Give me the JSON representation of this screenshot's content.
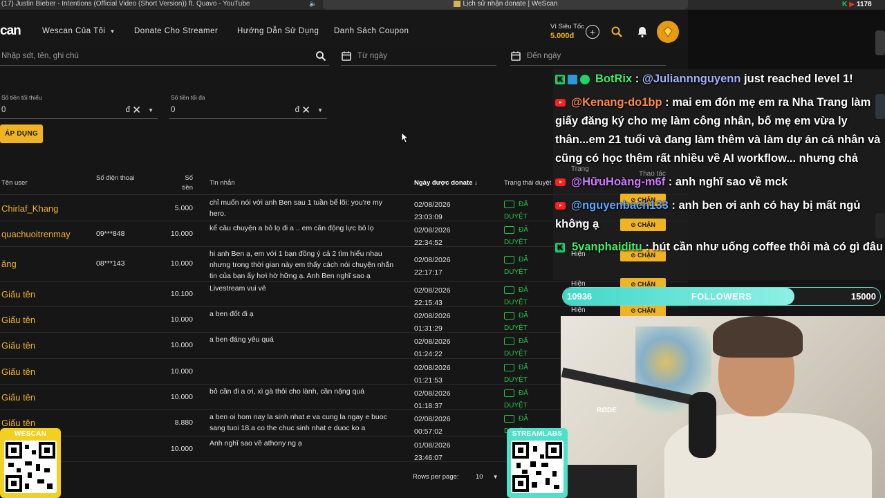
{
  "browser": {
    "left_tab": "(17) Justin Bieber - Intentions (Official Video (Short Version)) ft. Quavo - YouTube",
    "right_tab": "Lịch sử nhận donate | WeScan"
  },
  "nav": {
    "logo": "can",
    "items": [
      {
        "label": "Wescan Của Tôi",
        "has_caret": true
      },
      {
        "label": "Donate Cho Streamer"
      },
      {
        "label": "Hướng Dẫn Sử Dụng"
      },
      {
        "label": "Danh Sách Coupon"
      }
    ],
    "wallet_label": "Ví Siêu Tốc",
    "wallet_amount": "5.000đ"
  },
  "filters": {
    "search_placeholder": "Nhập sdt, tên, ghi chú",
    "from_date_placeholder": "Từ ngày",
    "to_date_placeholder": "Đến ngày",
    "min_label": "Số tiền tối thiểu",
    "min_value": "0",
    "max_label": "Số tiền tối đa",
    "max_value": "0",
    "currency": "đ",
    "apply_label": "ÁP DỤNG"
  },
  "table": {
    "headers": {
      "user": "Tên user",
      "phone": "Số điện thoại",
      "amount_l1": "Số",
      "amount_l2": "tiền",
      "message": "Tin nhắn",
      "date": "Ngày được donate",
      "status": "Trạng thái duyệt"
    },
    "rows": [
      {
        "user": "Chirlaf_Khang",
        "phone": "",
        "amount": "5.000",
        "message": "chỉ muốn nói với anh Ben sau 1 tuần bể lõi: you're my hero.",
        "date": "02/08/2026",
        "time": "23:03:09",
        "s1": "ĐÃ",
        "s2": "DUYỆT"
      },
      {
        "user": "quachuoitrenmay",
        "phone": "09***848",
        "amount": "10.000",
        "message": "kể câu chuyện a bỏ lọ đi a .. em cần động lực bỏ lọ",
        "date": "02/08/2026",
        "time": "22:34:52",
        "s1": "ĐÃ",
        "s2": "DUYỆT"
      },
      {
        "user": "ăng",
        "phone": "08***143",
        "amount": "10.000",
        "message": "hi anh Ben ạ, em với 1 bạn đồng ý cả 2 tìm hiểu nhau nhưng trong thời gian này em thấy cách nói chuyện nhắn tin của bạn ấy hơi hờ hững ạ. Anh Ben nghĩ sao ạ",
        "date": "02/08/2026",
        "time": "22:17:17",
        "s1": "ĐÃ",
        "s2": "DUYỆT"
      },
      {
        "user": "Giấu tên",
        "phone": "",
        "amount": "10.100",
        "message": "Livestream vui vẻ",
        "date": "02/08/2026",
        "time": "22:15:43",
        "s1": "ĐÃ",
        "s2": "DUYỆT"
      },
      {
        "user": "Giấu tên",
        "phone": "",
        "amount": "10.000",
        "message": "a ben đốt đi ạ",
        "date": "02/08/2026",
        "time": "01:31:29",
        "s1": "ĐÃ",
        "s2": "DUYỆT"
      },
      {
        "user": "Giấu tên",
        "phone": "",
        "amount": "10.000",
        "message": "a ben đáng yêu quá",
        "date": "02/08/2026",
        "time": "01:24:22",
        "s1": "ĐÃ",
        "s2": "DUYỆT"
      },
      {
        "user": "Giấu tên",
        "phone": "",
        "amount": "10.000",
        "message": "",
        "date": "02/08/2026",
        "time": "01:21:53",
        "s1": "ĐÃ",
        "s2": "DUYỆT"
      },
      {
        "user": "Giấu tên",
        "phone": "",
        "amount": "10.000",
        "message": "bỏ cần đi a ơi, xì gà thôi cho lành, cần nặng quá",
        "date": "02/08/2026",
        "time": "01:18:37",
        "s1": "ĐÃ",
        "s2": "DUYỆT"
      },
      {
        "user": "Giấu tên",
        "phone": "",
        "amount": "8.880",
        "message": "a ben oi hom nay la sinh nhat e va cung la ngay e buoc sang tuoi 18.a co the chuc sinh nhat e duoc ko a",
        "date": "02/08/2026",
        "time": "00:57:02",
        "s1": "ĐÃ",
        "s2": "DUYỆT"
      },
      {
        "user": "",
        "phone": "",
        "amount": "10.000",
        "message": "Anh nghĩ sao về athony ng ạ",
        "date": "01/08/2026",
        "time": "23:46:07",
        "s1": "",
        "s2": ""
      }
    ],
    "rows_per_page_label": "Rows per page:",
    "rows_per_page": "10"
  },
  "overlay": {
    "yt_count": "1178",
    "chat": [
      {
        "name": "BotRix",
        "sep": " : ",
        "mention": "@Juliannnguyenn",
        "text": " just reached level 1!"
      },
      {
        "name": "@Kenang-do1bp",
        "text": " : mai em đón mẹ em ra Nha Trang làm giấy đăng ký cho mẹ làm công nhân, bố mẹ em vừa ly thân...em 21 tuổi và đang làm thêm và làm dự án cá nhân và cũng có học thêm rất nhiều về AI workflow... nhưng chả"
      },
      {
        "name": "@HữuHoàng-m6f",
        "text": " : anh nghĩ sao về mck"
      },
      {
        "name": "@nguyenbach133",
        "text": " : anh ben ơi anh có hay bị mất ngủ không ạ"
      },
      {
        "name": "5vanphaiditu",
        "text": " : hút cần như uống coffee thôi mà có gì đâu"
      }
    ],
    "ghost": {
      "status_header": "Trạng",
      "action_header": "Thao tác",
      "status_text": "Hiện",
      "ban_label": "CHẶN"
    },
    "followers": {
      "current": "10936",
      "label": "FOLLOWERS",
      "goal": "15000",
      "progress": 0.729
    },
    "qr_left_title": "WESCAN",
    "qr_right_title": "STREAMLABS",
    "rode": "RØDE"
  },
  "colors": {
    "accent": "#f0b323",
    "approved": "#24c24a",
    "bg": "#161616",
    "followers_bar": "#42d7c8",
    "qr_left": "#f0d020",
    "qr_right": "#4fe0c9"
  }
}
